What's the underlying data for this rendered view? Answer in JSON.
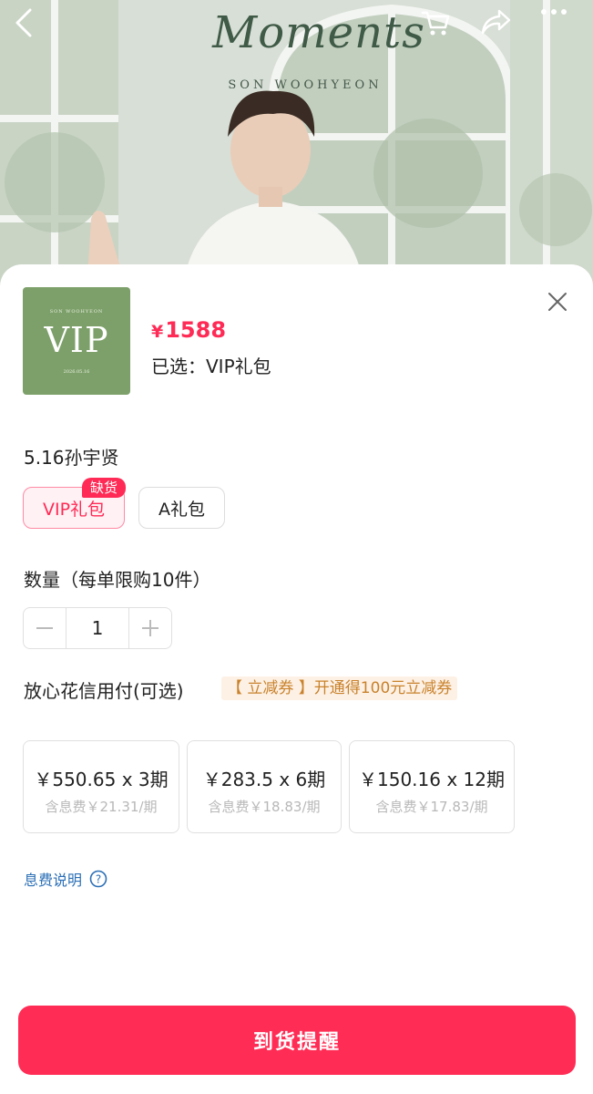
{
  "hero": {
    "title": "Moments",
    "subtitle": "SON WOOHYEON"
  },
  "topbar": {
    "icons": [
      "back-icon",
      "cart-icon",
      "share-icon",
      "more-icon"
    ]
  },
  "product": {
    "thumbnail": {
      "top_text": "SON WOOHYEON",
      "main_text": "VIP",
      "date_text": "2026.05.16"
    },
    "price_symbol": "¥",
    "price": "1588",
    "selected_text": "已选：VIP礼包"
  },
  "spec": {
    "label": "5.16孙宇贤",
    "options": [
      {
        "label": "VIP礼包",
        "tag": "缺货",
        "active": true
      },
      {
        "label": "A礼包",
        "active": false
      }
    ]
  },
  "quantity": {
    "label": "数量（每单限购10件）",
    "value": "1"
  },
  "credit": {
    "label": "放心花信用付(可选)",
    "coupon": "【 立减券 】开通得100元立减券",
    "plans": [
      {
        "main": "￥550.65 x 3期",
        "sub": "含息费￥21.31/期"
      },
      {
        "main": "￥283.5 x 6期",
        "sub": "含息费￥18.83/期"
      },
      {
        "main": "￥150.16 x 12期",
        "sub": "含息费￥17.83/期"
      }
    ],
    "fee_link": "息费说明"
  },
  "cta": {
    "label": "到货提醒"
  },
  "colors": {
    "accent": "#ff2a55",
    "coupon_text": "#c9822b",
    "link": "#2b6fb6"
  }
}
